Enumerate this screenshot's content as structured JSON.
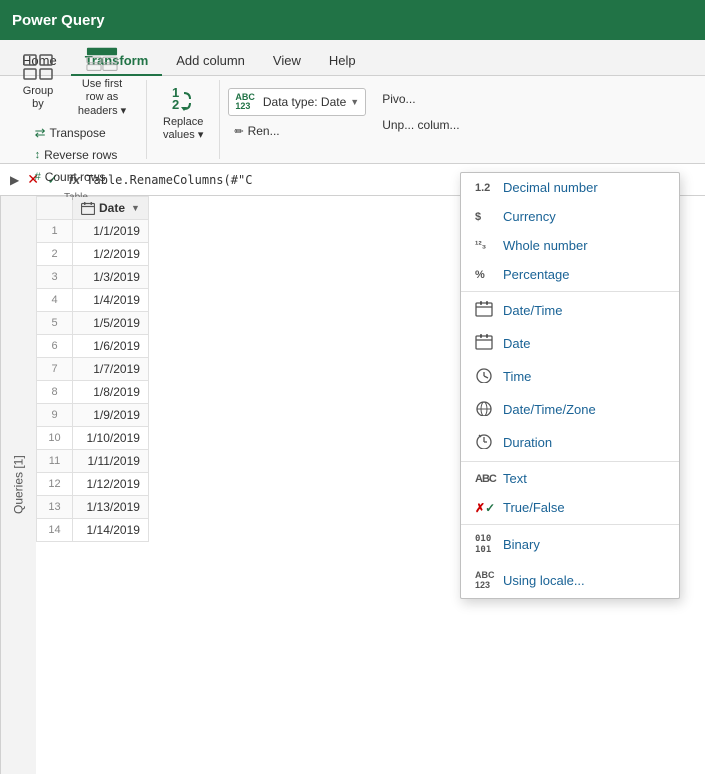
{
  "titleBar": {
    "label": "Power Query"
  },
  "tabs": [
    {
      "id": "home",
      "label": "Home",
      "active": false
    },
    {
      "id": "transform",
      "label": "Transform",
      "active": true
    },
    {
      "id": "add-column",
      "label": "Add column",
      "active": false
    },
    {
      "id": "view",
      "label": "View",
      "active": false
    },
    {
      "id": "help",
      "label": "Help",
      "active": false
    }
  ],
  "ribbon": {
    "groups": [
      {
        "id": "table",
        "label": "Table",
        "buttons_large": [
          {
            "id": "group-by",
            "label": "Group\nby"
          },
          {
            "id": "use-first-row",
            "label": "Use first row as\nheaders"
          }
        ],
        "buttons_small": [
          {
            "id": "transpose",
            "label": "Transpose"
          },
          {
            "id": "reverse-rows",
            "label": "Reverse rows"
          },
          {
            "id": "count-rows",
            "label": "Count rows"
          }
        ]
      }
    ],
    "replaceValues": {
      "label": "Replace\nvalues"
    },
    "dataType": {
      "icon": "ABC\n123",
      "label": "Data type: Date",
      "arrow": "▼"
    },
    "renameLabel": "Ren...",
    "pivotLabel": "Pivo...",
    "unpivotLabel": "Unp...",
    "columnLabel": "colum..."
  },
  "formulaBar": {
    "formula": "Table.RenameColumns(#\"C"
  },
  "queriesPanel": {
    "label": "Queries [1]"
  },
  "dataTypeDropdown": {
    "items": [
      {
        "id": "decimal",
        "icon": "1.2",
        "label": "Decimal number",
        "divider": false
      },
      {
        "id": "currency",
        "icon": "$",
        "label": "Currency",
        "divider": false
      },
      {
        "id": "whole",
        "icon": "¹²₃",
        "label": "Whole number",
        "divider": false
      },
      {
        "id": "percentage",
        "icon": "%",
        "label": "Percentage",
        "divider": false
      },
      {
        "id": "datetime",
        "icon": "📅",
        "label": "Date/Time",
        "divider": false
      },
      {
        "id": "date",
        "icon": "📅",
        "label": "Date",
        "divider": false
      },
      {
        "id": "time",
        "icon": "⏰",
        "label": "Time",
        "divider": false
      },
      {
        "id": "datetimezone",
        "icon": "🌐",
        "label": "Date/Time/Zone",
        "divider": false
      },
      {
        "id": "duration",
        "icon": "⏱",
        "label": "Duration",
        "divider": true
      },
      {
        "id": "text",
        "icon": "ABC",
        "label": "Text",
        "divider": false
      },
      {
        "id": "truefalse",
        "icon": "✓✗",
        "label": "True/False",
        "divider": true
      },
      {
        "id": "binary",
        "icon": "010\n101",
        "label": "Binary",
        "divider": false
      },
      {
        "id": "locale",
        "icon": "ABC\n123",
        "label": "Using locale...",
        "divider": false
      }
    ]
  },
  "grid": {
    "columnHeader": "Date",
    "rows": [
      {
        "num": 1,
        "date": "1/1/2019"
      },
      {
        "num": 2,
        "date": "1/2/2019"
      },
      {
        "num": 3,
        "date": "1/3/2019"
      },
      {
        "num": 4,
        "date": "1/4/2019"
      },
      {
        "num": 5,
        "date": "1/5/2019"
      },
      {
        "num": 6,
        "date": "1/6/2019"
      },
      {
        "num": 7,
        "date": "1/7/2019"
      },
      {
        "num": 8,
        "date": "1/8/2019"
      },
      {
        "num": 9,
        "date": "1/9/2019"
      },
      {
        "num": 10,
        "date": "1/10/2019"
      },
      {
        "num": 11,
        "date": "1/11/2019"
      },
      {
        "num": 12,
        "date": "1/12/2019"
      },
      {
        "num": 13,
        "date": "1/13/2019"
      },
      {
        "num": 14,
        "date": "1/14/2019"
      }
    ]
  }
}
